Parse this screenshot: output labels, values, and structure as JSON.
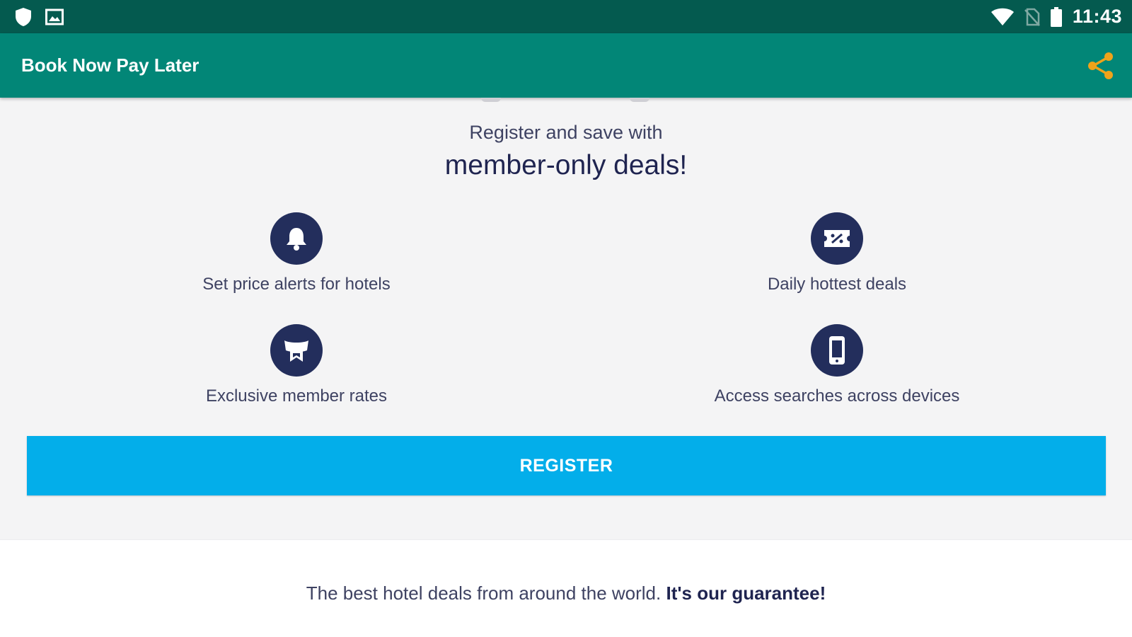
{
  "status_bar": {
    "time": "11:43",
    "icons": [
      "shield-icon",
      "image-icon",
      "wifi-icon",
      "no-sim-icon",
      "battery-icon"
    ]
  },
  "app_bar": {
    "title": "Book Now Pay Later",
    "share_icon": "share-icon",
    "share_color": "#f0a31a"
  },
  "hero": {
    "line1": "Register and save with",
    "line2": "member-only deals!"
  },
  "features": [
    {
      "icon": "bell-icon",
      "label": "Set price alerts for hotels"
    },
    {
      "icon": "discount-ticket-icon",
      "label": "Daily hottest deals"
    },
    {
      "icon": "ribbon-badge-icon",
      "label": "Exclusive member rates"
    },
    {
      "icon": "smartphone-icon",
      "label": "Access searches across devices"
    }
  ],
  "register": {
    "label": "REGISTER",
    "color": "#03aeea"
  },
  "footer": {
    "text": "The best hotel deals from around the world. ",
    "emphasis": "It's our guarantee!"
  },
  "colors": {
    "status_bar": "#045a4f",
    "app_bar": "#028677",
    "icon_circle": "#232e5c",
    "text_dark": "#1f2450"
  }
}
